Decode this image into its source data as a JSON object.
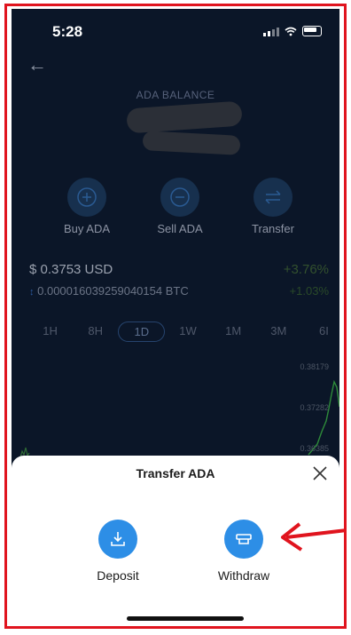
{
  "status": {
    "time": "5:28"
  },
  "balance": {
    "label": "ADA BALANCE"
  },
  "actions": [
    {
      "label": "Buy ADA",
      "icon": "plus-circle-icon"
    },
    {
      "label": "Sell ADA",
      "icon": "minus-circle-icon"
    },
    {
      "label": "Transfer",
      "icon": "transfer-arrows-icon"
    }
  ],
  "price": {
    "usd": "$ 0.3753 USD",
    "usd_change": "+3.76%",
    "btc": "0.000016039259040154 BTC",
    "btc_change": "+1.03%"
  },
  "ranges": [
    "1H",
    "8H",
    "1D",
    "1W",
    "1M",
    "3M",
    "6I"
  ],
  "selected_range": "1D",
  "chart_ticks": [
    "0.38179",
    "0.37282",
    "0.36385"
  ],
  "sheet": {
    "title": "Transfer ADA",
    "options": [
      {
        "label": "Deposit",
        "icon": "download-icon"
      },
      {
        "label": "Withdraw",
        "icon": "withdraw-card-icon"
      }
    ]
  },
  "colors": {
    "background": "#0b1628",
    "accent": "#2d8ee6",
    "annotation": "#e0141e",
    "chart_line": "#2e8b3a"
  }
}
